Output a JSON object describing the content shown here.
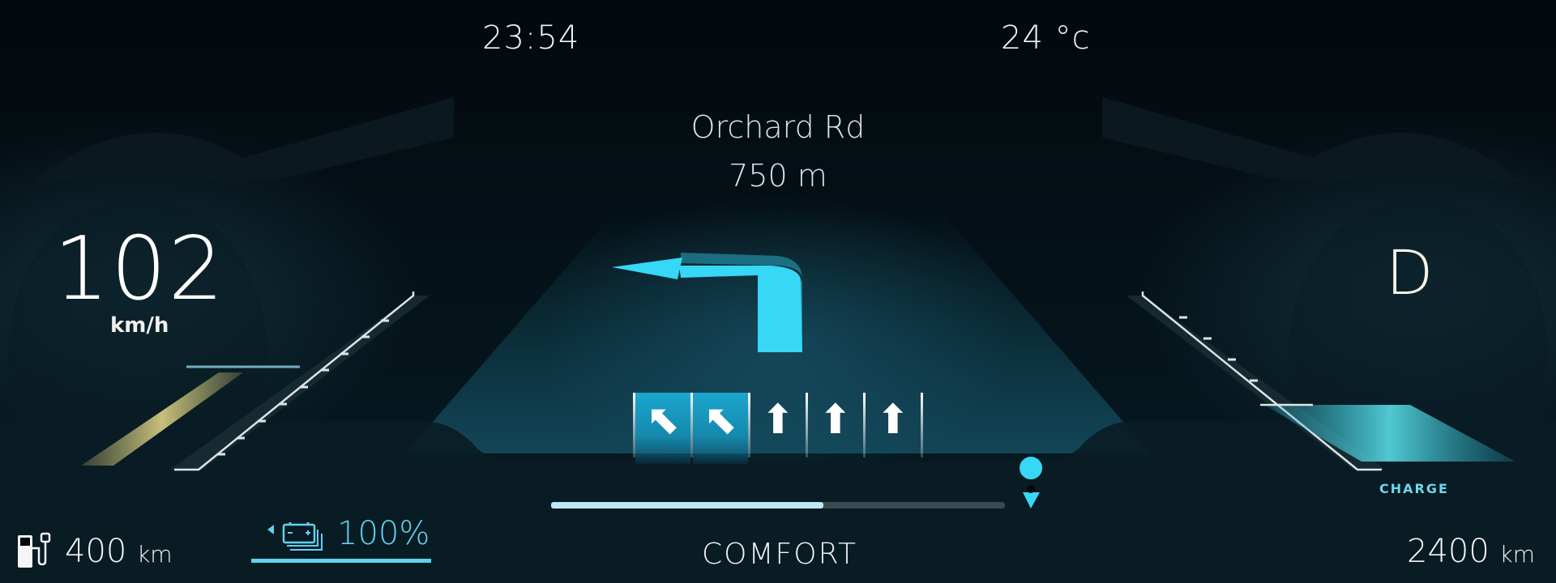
{
  "status_bar": {
    "time": "23:54",
    "temperature": "24 °c"
  },
  "navigation": {
    "street": "Orchard Rd",
    "distance": "750 m",
    "maneuver_icon": "turn-left-arrow-icon",
    "route_progress": 0.6,
    "destination_icon": "map-pin-icon",
    "lanes": [
      {
        "icon": "slight-left-arrow-icon",
        "glyph": "⬉",
        "active": true
      },
      {
        "icon": "slight-left-arrow-icon",
        "glyph": "⬉",
        "active": true
      },
      {
        "icon": "straight-arrow-icon",
        "glyph": "⬆",
        "active": false
      },
      {
        "icon": "straight-arrow-icon",
        "glyph": "⬆",
        "active": false
      },
      {
        "icon": "straight-arrow-icon",
        "glyph": "⬆",
        "active": false
      }
    ]
  },
  "speedometer": {
    "speed": "102",
    "unit": "km/h"
  },
  "gear": {
    "value": "D",
    "charge_label": "CHARGE"
  },
  "fuel": {
    "icon": "fuel-pump-icon",
    "range_value": "400",
    "range_unit": "km"
  },
  "battery": {
    "icon": "battery-icon",
    "level": "100%"
  },
  "drive_mode": "COMFORT",
  "odometer": {
    "value": "2400",
    "unit": "km"
  },
  "colors": {
    "accent": "#36d8f5",
    "lane_active": "#1ba6cf",
    "gear_bar": "#e2d68a"
  }
}
